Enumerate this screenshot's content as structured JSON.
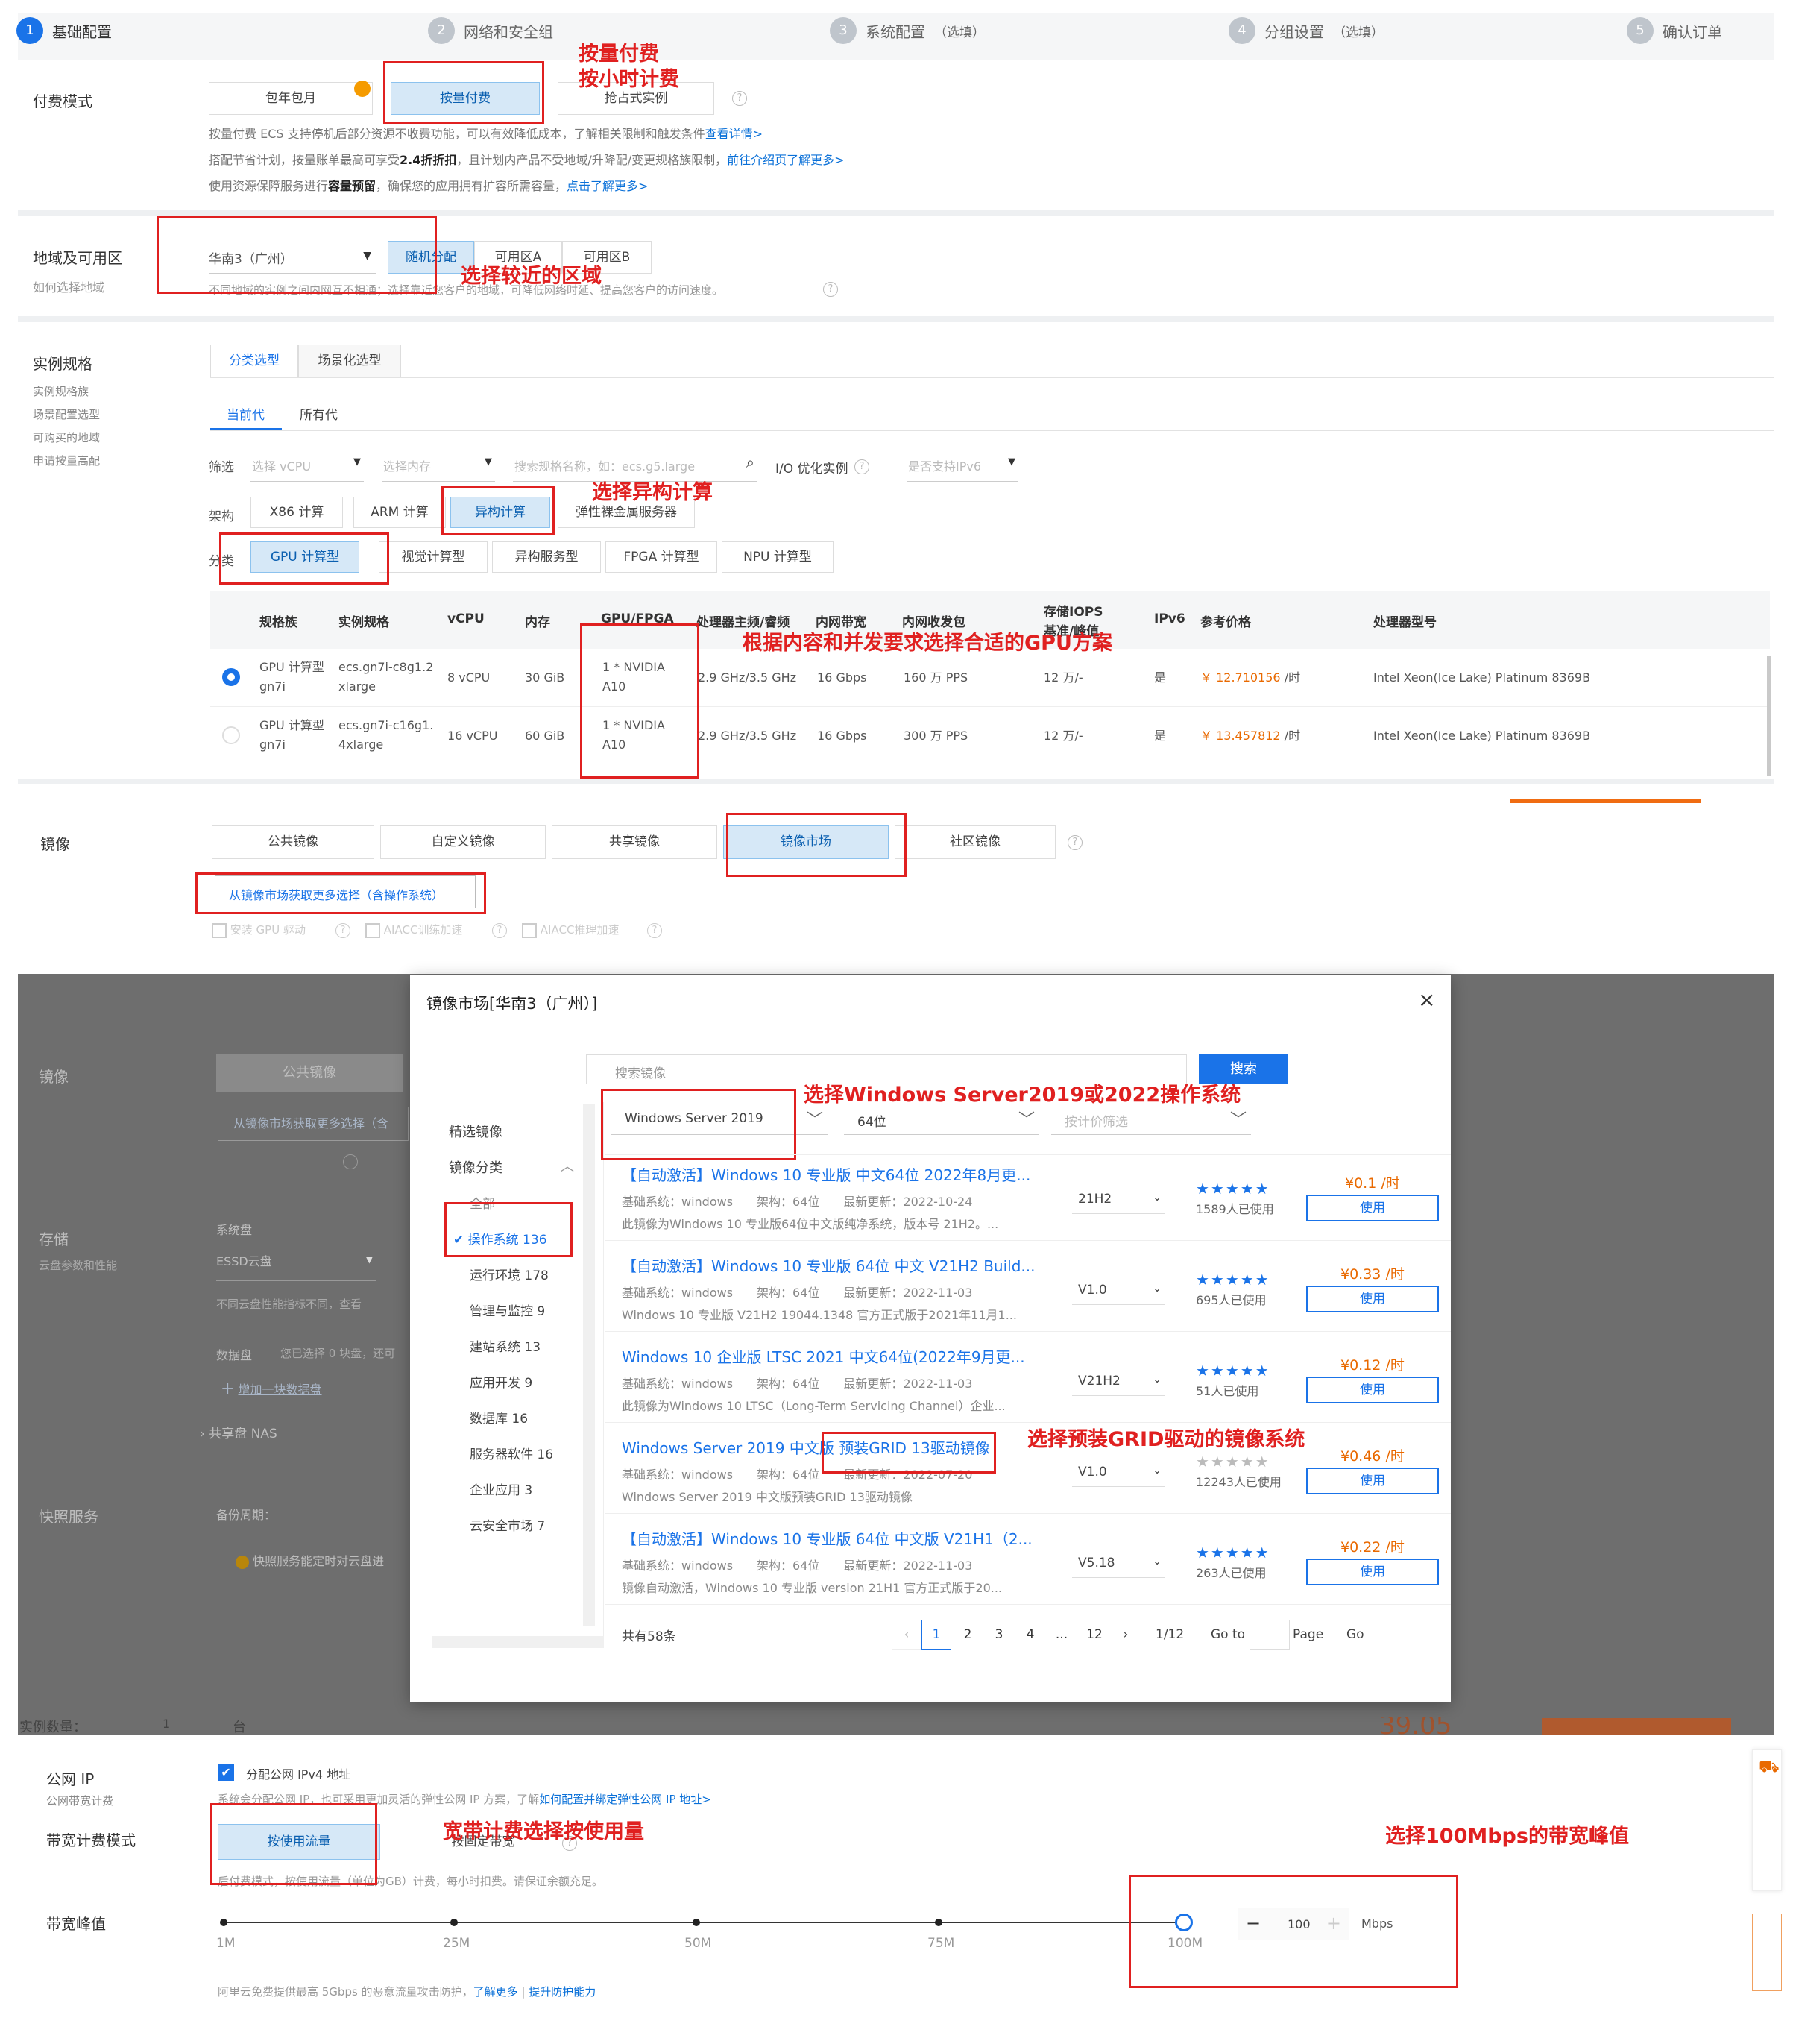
{
  "steps": [
    {
      "num": "1",
      "label": "基础配置",
      "extra": ""
    },
    {
      "num": "2",
      "label": "网络和安全组",
      "extra": ""
    },
    {
      "num": "3",
      "label": "系统配置",
      "extra": "（选填）"
    },
    {
      "num": "4",
      "label": "分组设置",
      "extra": "（选填）"
    },
    {
      "num": "5",
      "label": "确认订单",
      "extra": ""
    }
  ],
  "billing": {
    "label": "付费模式",
    "options": [
      "包年包月",
      "按量付费",
      "抢占式实例"
    ],
    "note1": "按量付费 ECS 支持停机后部分资源不收费功能，可以有效降低成本，了解相关限制和触发条件",
    "note1_link": "查看详情>",
    "note2": "搭配节省计划，按量账单最高可享受",
    "note2_bold": "2.4折折扣",
    "note2b": "，且计划内产品不受地域/升降配/变更规格族限制，",
    "note2_link": "前往介绍页了解更多>",
    "note3": "使用资源保障服务进行",
    "note3_bold": "容量预留",
    "note3b": "，确保您的应用拥有扩容所需容量，",
    "note3_link": "点击了解更多>"
  },
  "region": {
    "label": "地域及可用区",
    "sublabel": "如何选择地域",
    "selected": "华南3（广州）",
    "zones": [
      "随机分配",
      "可用区A",
      "可用区B"
    ],
    "note": "不同地域的实例之间内网互不相通；选择靠近您客户的地域，可降低网络时延、提高您客户的访问速度。"
  },
  "spec": {
    "label": "实例规格",
    "sublabels": [
      "实例规格族",
      "场景配置选型",
      "可购买的地域",
      "申请按量高配"
    ],
    "tabs": [
      "分类选型",
      "场景化选型"
    ],
    "gen_tabs": [
      "当前代",
      "所有代"
    ],
    "filter_label": "筛选",
    "filter_cpu": "选择 vCPU",
    "filter_mem": "选择内存",
    "filter_search": "搜索规格名称，如：ecs.g5.large",
    "filter_io": "I/O 优化实例",
    "filter_ipv6": "是否支持IPv6",
    "arch_label": "架构",
    "arch": [
      "X86 计算",
      "ARM 计算",
      "异构计算",
      "弹性裸金属服务器"
    ],
    "cat_label": "分类",
    "cats": [
      "GPU 计算型",
      "视觉计算型",
      "异构服务型",
      "FPGA 计算型",
      "NPU 计算型"
    ],
    "headers": [
      "规格族",
      "实例规格",
      "vCPU",
      "内存",
      "GPU/FPGA",
      "处理器主频/睿频",
      "内网带宽",
      "内网收发包",
      "存储IOPS",
      "基准/峰值",
      "IPv6",
      "参考价格",
      "处理器型号"
    ],
    "rows": [
      {
        "family": "GPU 计算型 gn7i",
        "spec": "ecs.gn7i-c8g1.2xlarge",
        "vcpu": "8 vCPU",
        "mem": "30 GiB",
        "gpu": "1 * NVIDIA A10",
        "freq": "2.9 GHz/3.5 GHz",
        "bw": "16 Gbps",
        "pps": "160 万 PPS",
        "iops": "12 万/-",
        "ipv6": "是",
        "price": "￥ 12.710156",
        "unit": "/时",
        "cpu": "Intel Xeon(Ice Lake) Platinum 8369B"
      },
      {
        "family": "GPU 计算型 gn7i",
        "spec": "ecs.gn7i-c16g1.4xlarge",
        "vcpu": "16 vCPU",
        "mem": "60 GiB",
        "gpu": "1 * NVIDIA A10",
        "freq": "2.9 GHz/3.5 GHz",
        "bw": "16 Gbps",
        "pps": "300 万 PPS",
        "iops": "12 万/-",
        "ipv6": "是",
        "price": "￥ 13.457812",
        "unit": "/时",
        "cpu": "Intel Xeon(Ice Lake) Platinum 8369B"
      }
    ]
  },
  "image": {
    "label": "镜像",
    "tabs": [
      "公共镜像",
      "自定义镜像",
      "共享镜像",
      "镜像市场",
      "社区镜像"
    ],
    "market_btn": "从镜像市场获取更多选择（含操作系统）",
    "opts": [
      "安装 GPU 驱动",
      "AIACC训练加速",
      "AIACC推理加速"
    ]
  },
  "overlay": {
    "image_label": "镜像",
    "image_tab": "公共镜像",
    "market_btn": "从镜像市场获取更多选择（含",
    "storage_label": "存储",
    "storage_sub": "云盘参数和性能",
    "sys_disk": "系统盘",
    "essd": "ESSD云盘",
    "disk_note": "不同云盘性能指标不同，查看",
    "data_disk": "数据盘",
    "data_note": "您已选择 0 块盘，还可",
    "add_disk": "增加一块数据盘",
    "nas": "共享盘 NAS",
    "snap_label": "快照服务",
    "backup": "备份周期：",
    "snap_note": "快照服务能定时对云盘进",
    "qty_label": "实例数量：",
    "qty": "1",
    "qty_unit": "台",
    "price": "39.05"
  },
  "modal": {
    "title": "镜像市场[华南3（广州）]",
    "search_placeholder": "搜索镜像",
    "search_btn": "搜索",
    "side_title": "精选镜像",
    "side_cat": "镜像分类",
    "side_items": [
      "全部",
      "操作系统 136",
      "运行环境 178",
      "管理与监控 9",
      "建站系统 13",
      "应用开发 9",
      "数据库 16",
      "服务器软件 16",
      "企业应用 3",
      "云安全市场 7"
    ],
    "filter_os": "Windows Server 2019",
    "filter_bit": "64位",
    "filter_price": "按计价筛选",
    "items": [
      {
        "title": "【自动激活】Windows 10 专业版 中文64位 2022年8月更...",
        "meta": "基础系统：windows　　架构：64位　　最新更新：2022-10-24",
        "desc": "此镜像为Windows 10 专业版64位中文版纯净系统，版本号 21H2。...",
        "ver": "21H2",
        "users": "1589人已使用",
        "price": "¥0.1 /时",
        "use": "使用"
      },
      {
        "title": "【自动激活】Windows 10 专业版 64位 中文 V21H2 Build...",
        "meta": "基础系统：windows　　架构：64位　　最新更新：2022-11-03",
        "desc": "Windows 10 专业版 V21H2 19044.1348 官方正式版于2021年11月1...",
        "ver": "V1.0",
        "users": "695人已使用",
        "price": "¥0.33 /时",
        "use": "使用"
      },
      {
        "title": "Windows 10 企业版 LTSC 2021 中文64位(2022年9月更...",
        "meta": "基础系统：windows　　架构：64位　　最新更新：2022-11-03",
        "desc": "此镜像为Windows 10 LTSC（Long-Term Servicing Channel）企业...",
        "ver": "V21H2",
        "users": "51人已使用",
        "price": "¥0.12 /时",
        "use": "使用"
      },
      {
        "title": "Windows Server 2019 中文版 预装GRID 13驱动镜像",
        "meta": "基础系统：windows　　架构：64位　　最新更新：2022-07-20",
        "desc": "Windows Server 2019 中文版预装GRID 13驱动镜像",
        "ver": "V1.0",
        "users": "12243人已使用",
        "price": "¥0.46 /时",
        "use": "使用"
      },
      {
        "title": "【自动激活】Windows 10 专业版 64位 中文版 V21H1（2...",
        "meta": "基础系统：windows　　架构：64位　　最新更新：2022-11-03",
        "desc": "镜像自动激活，Windows 10 专业版 version 21H1 官方正式版于20...",
        "ver": "V5.18",
        "users": "263人已使用",
        "price": "¥0.22 /时",
        "use": "使用"
      }
    ],
    "total": "共有58条",
    "pages": [
      "1",
      "2",
      "3",
      "4",
      "...",
      "12"
    ],
    "page_info": "1/12",
    "goto": "Go to",
    "page_word": "Page",
    "go": "Go"
  },
  "network": {
    "ip_label": "公网 IP",
    "ip_sub": "公网带宽计费",
    "ip_check": "分配公网 IPv4 地址",
    "ip_note": "系统会分配公网 IP，也可采用更加灵活的弹性公网 IP 方案，了解",
    "ip_link": "如何配置并绑定弹性公网 IP 地址>",
    "bw_mode_label": "带宽计费模式",
    "bw_modes": [
      "按使用流量",
      "按固定带宽"
    ],
    "bw_note": "后付费模式，按使用流量（单位为GB）计费，每小时扣费。请保证余额充足。",
    "peak_label": "带宽峰值",
    "ticks": [
      "1M",
      "25M",
      "50M",
      "75M",
      "100M"
    ],
    "value": "100",
    "unit": "Mbps",
    "ddos": "阿里云免费提供最高 5Gbps 的恶意流量攻击防护，",
    "ddos_link1": "了解更多",
    "ddos_link2": "提升防护能力"
  },
  "annotations": {
    "a1": "按量付费",
    "a2": "按小时计费",
    "a3": "选择较近的区域",
    "a4": "选择异构计算",
    "a5": "根据内容和并发要求选择合适的GPU方案",
    "a6": "选择Windows Server2019或2022操作系统",
    "a7": "选择预装GRID驱动的镜像系统",
    "a8": "宽带计费选择按使用量",
    "a9": "选择100Mbps的带宽峰值"
  },
  "colors": {
    "accent": "#1a73e8",
    "annotation": "#e02020",
    "price": "#e96900",
    "overlay": "#6e6e6e"
  }
}
